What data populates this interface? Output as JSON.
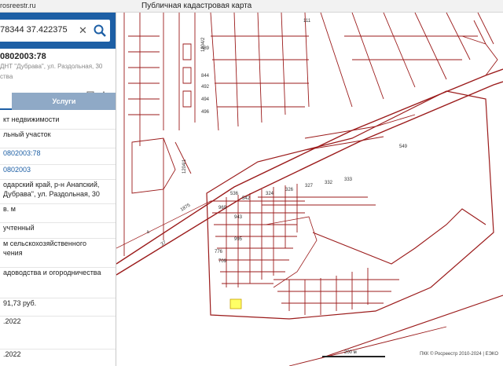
{
  "browser": {
    "url": "rosreestr.ru"
  },
  "app": {
    "title": "Публичная кадастровая карта"
  },
  "search": {
    "value": "78344 37.422375",
    "clear_icon": "close-icon",
    "search_icon": "search-icon"
  },
  "panel": {
    "collapse_icon": "chevron-left-icon"
  },
  "object": {
    "number": "0802003:78",
    "address_short": "ДНТ \"Дубрава\", ул. Раздольная, 30",
    "type": "ства",
    "tools": [
      "plan-icon",
      "star-icon"
    ]
  },
  "tabs": [
    {
      "label": ""
    },
    {
      "label": "Услуги"
    }
  ],
  "info": [
    {
      "text": "кт недвижимости"
    },
    {
      "text": "льный участок"
    },
    {
      "text": "0802003:78",
      "link": true
    },
    {
      "text": "0802003",
      "link": true
    },
    {
      "text": "одарский край, р-н Анапский,"
    },
    {
      "text": "Дубрава\", ул. Раздольная, 30"
    },
    {
      "text": "в. м"
    },
    {
      "text": "учтенный"
    },
    {
      "text": "м сельскохозяйственного"
    },
    {
      "text": "чения"
    },
    {
      "text": "адоводства и огородничества"
    },
    {
      "text": "91,73 руб."
    },
    {
      "text": ".2022"
    },
    {
      "text": ".2022"
    }
  ],
  "map": {
    "labels": {
      "road_1204_1": "1204/1",
      "road_1204_2": "1204/2",
      "road_1875": "1875",
      "road_37": "37",
      "road_4": "4",
      "parcel_549": "549",
      "parcels_top": [
        "489",
        "844",
        "492",
        "494",
        "496",
        "111"
      ],
      "parcels_mid": [
        "324",
        "326",
        "327",
        "332",
        "333"
      ],
      "parcels_lower": [
        "536",
        "542",
        "969",
        "943",
        "995",
        "709",
        "776"
      ]
    },
    "scale": "200 м",
    "copyright": "ПКК © Росреестр 2010-2024 | ЕЭКО",
    "highlight_color": "#ffff66",
    "line_color": "#9b1b1b"
  }
}
